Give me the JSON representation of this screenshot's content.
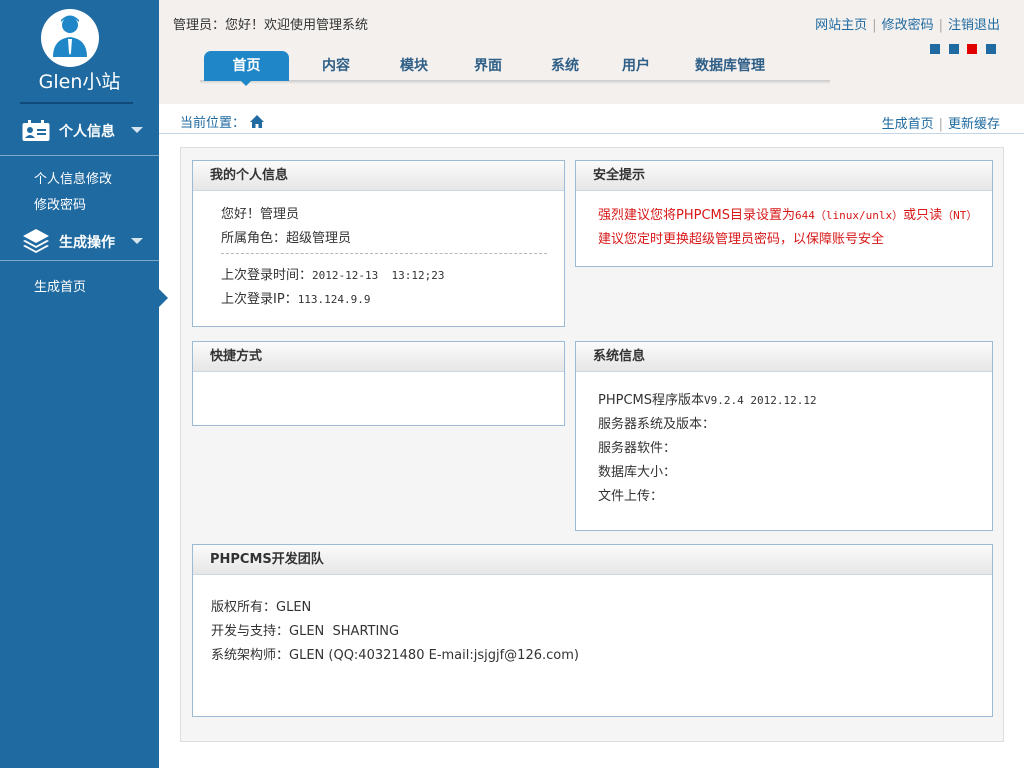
{
  "sidebar": {
    "logo_text": "Glen小站",
    "sections": [
      {
        "label": "个人信息",
        "icon": "id-card-icon",
        "items": [
          "个人信息修改",
          "修改密码"
        ]
      },
      {
        "label": "生成操作",
        "icon": "layers-icon",
        "items": [
          "生成首页"
        ]
      }
    ]
  },
  "header": {
    "welcome": "管理员：您好！欢迎使用管理系统",
    "links": [
      "网站主页",
      "修改密码",
      "注销退出"
    ],
    "skin_colors": [
      "#1f6aa0",
      "#1f6aa0",
      "#e00000",
      "#1f6aa0"
    ],
    "nav": [
      "首页",
      "内容",
      "模块",
      "界面",
      "系统",
      "用户",
      "数据库管理"
    ],
    "active_nav": "首页"
  },
  "breadcrumb": {
    "label": "当前位置：",
    "icon": "home-icon",
    "actions": [
      "生成首页",
      "更新缓存"
    ]
  },
  "panels": {
    "personal": {
      "title": "我的个人信息",
      "greeting": "您好！管理员",
      "role": "所属角色：超级管理员",
      "last_login_time_label": "上次登录时间：",
      "last_login_time": "2012-12-13  13:12;23",
      "last_login_ip_label": "上次登录IP：",
      "last_login_ip": "113.124.9.9"
    },
    "security": {
      "title": "安全提示",
      "line1_a": "强烈建议您将PHPCMS目录设置为",
      "line1_b": "644（linux/unlx）",
      "line1_c": "或只读",
      "line1_d": "（NT）",
      "line2": "建议您定时更换超级管理员密码，以保障账号安全"
    },
    "shortcuts": {
      "title": "快捷方式"
    },
    "system": {
      "title": "系统信息",
      "version_label": "PHPCMS程序版本",
      "version": "V9.2.4 2012.12.12",
      "os": "服务器系统及版本：",
      "software": "服务器软件：",
      "db_size": "数据库大小：",
      "upload": "文件上传："
    },
    "team": {
      "title": "PHPCMS开发团队",
      "copyright": "版权所有：GLEN",
      "dev": "开发与支持：GLEN  SHARTING",
      "architect": "系统架构师：GLEN (QQ:40321480 E-mail:jsjgjf@126.com)"
    }
  }
}
